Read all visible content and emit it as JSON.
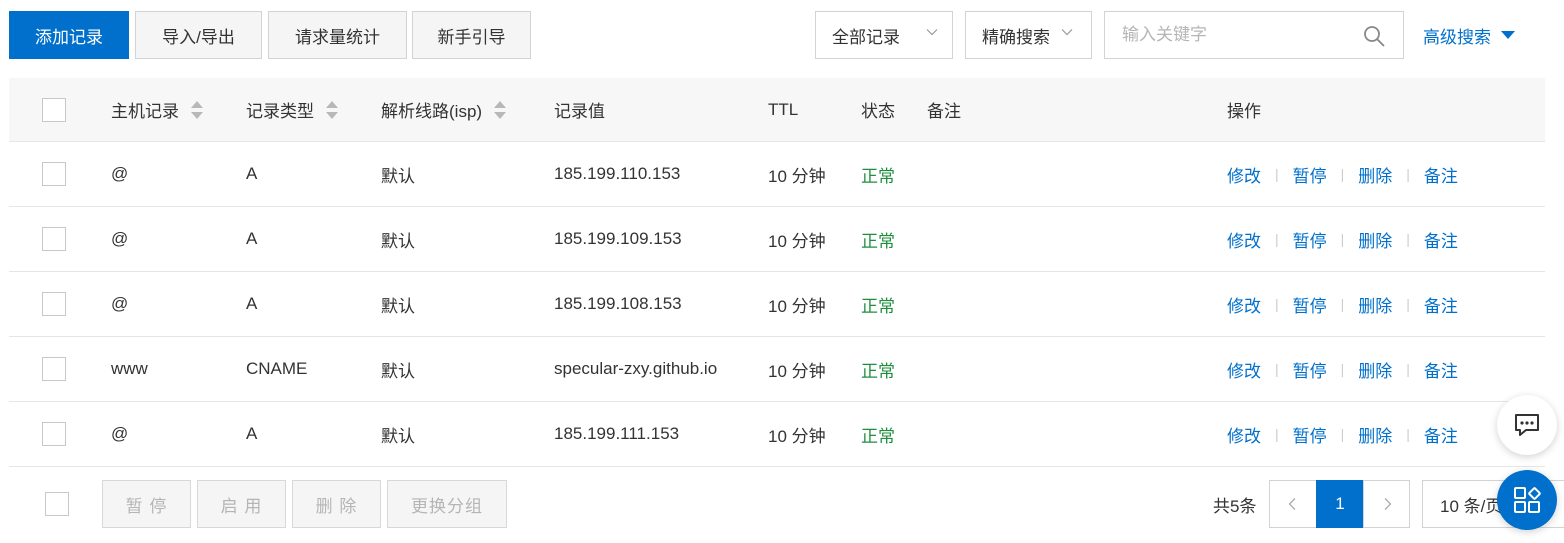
{
  "toolbar": {
    "add_label": "添加记录",
    "import_export_label": "导入/导出",
    "stats_label": "请求量统计",
    "guide_label": "新手引导",
    "filter_select": "全部记录",
    "search_mode_select": "精确搜索",
    "search_placeholder": "输入关键字",
    "advanced_search_label": "高级搜索"
  },
  "table": {
    "columns": {
      "host": "主机记录",
      "type": "记录类型",
      "line": "解析线路(isp)",
      "value": "记录值",
      "ttl": "TTL",
      "status": "状态",
      "remark": "备注",
      "ops": "操作"
    },
    "rows": [
      {
        "host": "@",
        "type": "A",
        "line": "默认",
        "value": "185.199.110.153",
        "ttl": "10 分钟",
        "status": "正常",
        "remark": ""
      },
      {
        "host": "@",
        "type": "A",
        "line": "默认",
        "value": "185.199.109.153",
        "ttl": "10 分钟",
        "status": "正常",
        "remark": ""
      },
      {
        "host": "@",
        "type": "A",
        "line": "默认",
        "value": "185.199.108.153",
        "ttl": "10 分钟",
        "status": "正常",
        "remark": ""
      },
      {
        "host": "www",
        "type": "CNAME",
        "line": "默认",
        "value": "specular-zxy.github.io",
        "ttl": "10 分钟",
        "status": "正常",
        "remark": ""
      },
      {
        "host": "@",
        "type": "A",
        "line": "默认",
        "value": "185.199.111.153",
        "ttl": "10 分钟",
        "status": "正常",
        "remark": ""
      }
    ],
    "row_actions": {
      "edit": "修改",
      "pause": "暂停",
      "delete": "删除",
      "remark": "备注"
    }
  },
  "footer": {
    "bulk_pause": "暂 停",
    "bulk_enable": "启 用",
    "bulk_delete": "删 除",
    "bulk_change_group": "更换分组",
    "total": "共5条",
    "current_page": "1",
    "page_size": "10 条/页"
  },
  "icons": {
    "search": "search-icon",
    "chat": "chat-icon",
    "apps": "apps-icon"
  },
  "colors": {
    "primary": "#0070cc",
    "status_ok": "#1e8e3e"
  }
}
